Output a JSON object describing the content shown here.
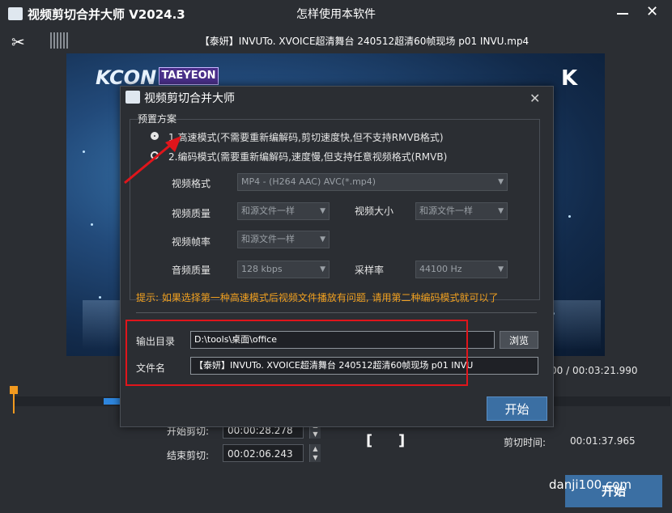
{
  "window": {
    "app_title": "视频剪切合并大师 V2024.3",
    "help_title": "怎样使用本软件",
    "file_title": "【泰妍】INVUTo. XVOICE超清舞台 240512超清60帧现场 p01 INVU.mp4"
  },
  "video": {
    "logo_text": "KCON",
    "badge_text": "TAEYEON",
    "corner_logo": "K"
  },
  "timeline": {
    "total_time": "00 / 00:03:21.990"
  },
  "bottom": {
    "start_cut_label": "开始剪切:",
    "start_cut_value": "00:00:28.278",
    "end_cut_label": "结束剪切:",
    "end_cut_value": "00:02:06.243",
    "bracket_left": "[",
    "bracket_right": "]",
    "cut_time_label": "剪切时间:",
    "cut_time_value": "00:01:37.965",
    "start_button": "开始"
  },
  "dialog": {
    "title": "视频剪切合并大师",
    "preset_label": "预置方案",
    "option1": "1.高速模式(不需要重新编解码,剪切速度快,但不支持RMVB格式)",
    "option2": "2.编码模式(需要重新编解码,速度慢,但支持任意视频格式(RMVB)",
    "video_format_label": "视频格式",
    "video_format_value": "MP4 - (H264 AAC) AVC(*.mp4)",
    "video_quality_label": "视频质量",
    "video_quality_value": "和源文件一样",
    "video_size_label": "视频大小",
    "video_size_value": "和源文件一样",
    "video_fps_label": "视频帧率",
    "video_fps_value": "和源文件一样",
    "audio_quality_label": "音频质量",
    "audio_quality_value": "128 kbps",
    "sample_rate_label": "采样率",
    "sample_rate_value": "44100 Hz",
    "hint": "提示: 如果选择第一种高速模式后视频文件播放有问题, 请用第二种编码模式就可以了",
    "output_dir_label": "输出目录",
    "output_dir_value": "D:\\tools\\桌面\\office",
    "browse_button": "浏览",
    "filename_label": "文件名",
    "filename_value": "【泰妍】INVUTo. XVOICE超清舞台 240512超清60帧现场 p01 INVU",
    "start_button": "开始",
    "selected_option": 1
  },
  "watermark": "danji100.com",
  "colors": {
    "background": "#2b2e33",
    "accent": "#3b6fa3",
    "hint": "#f0a020",
    "highlight_box": "#e0151b",
    "playhead": "#f29a1f",
    "segment": "#2e86de"
  }
}
